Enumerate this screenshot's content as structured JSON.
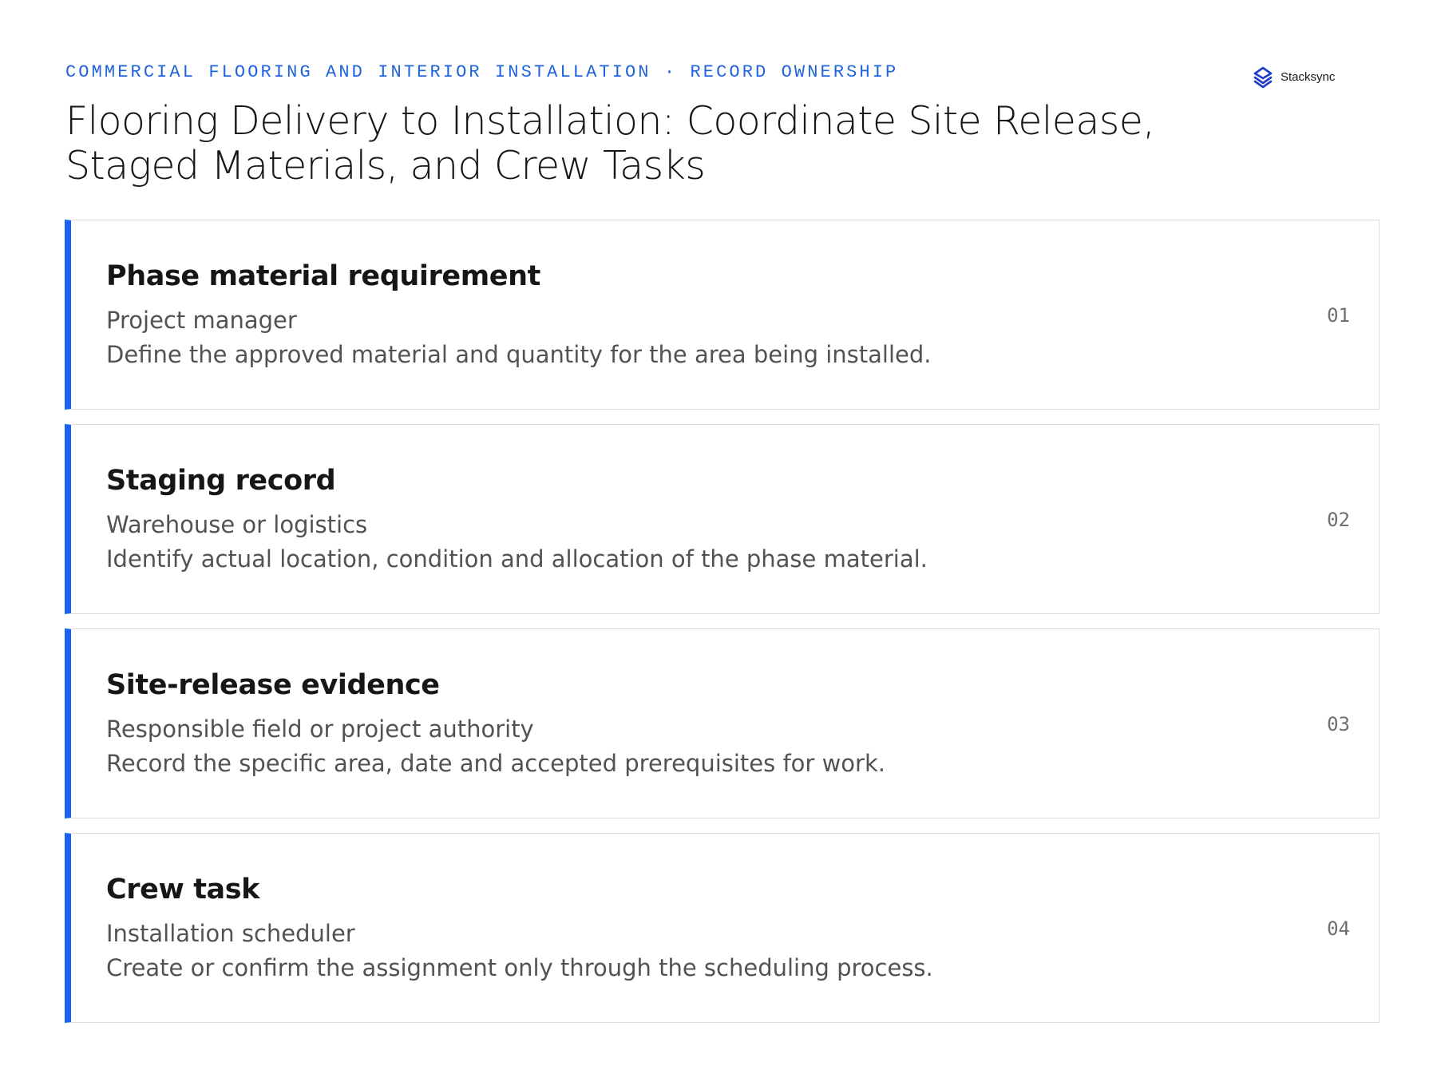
{
  "header": {
    "eyebrow": "COMMERCIAL FLOORING AND INTERIOR INSTALLATION · RECORD OWNERSHIP",
    "title": "Flooring Delivery to Installation: Coordinate Site Release, Staged Materials, and Crew Tasks"
  },
  "brand": {
    "name": "Stacksync",
    "logo_icon": "stacksync-logo-icon",
    "color": "#1f3ccf"
  },
  "colors": {
    "accent": "#1a63f0",
    "eyebrow": "#1f63dd"
  },
  "cards": [
    {
      "title": "Phase material requirement",
      "owner": "Project manager",
      "description": "Define the approved material and quantity for the area being installed.",
      "number": "01"
    },
    {
      "title": "Staging record",
      "owner": "Warehouse or logistics",
      "description": "Identify actual location, condition and allocation of the phase material.",
      "number": "02"
    },
    {
      "title": "Site-release evidence",
      "owner": "Responsible field or project authority",
      "description": "Record the specific area, date and accepted prerequisites for work.",
      "number": "03"
    },
    {
      "title": "Crew task",
      "owner": "Installation scheduler",
      "description": "Create or confirm the assignment only through the scheduling process.",
      "number": "04"
    }
  ]
}
